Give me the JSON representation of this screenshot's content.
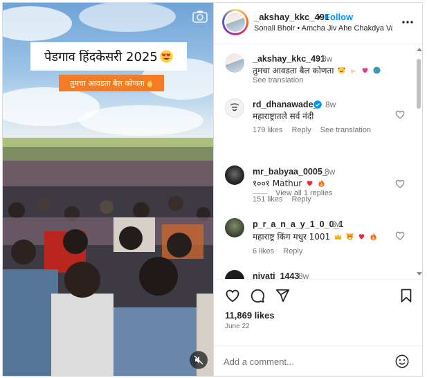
{
  "media": {
    "overlay_title": "पेडगाव हिंदकेसरी 2025",
    "overlay_subtitle": "तुमचा आवडता बैल कोणता",
    "camera_icon": "camera-icon",
    "mute_icon": "speaker-muted-icon",
    "colors": {
      "subtitle_bg": "#f47c24",
      "title_bg": "#ffffff"
    }
  },
  "header": {
    "username": "_akshay_kkc_491",
    "separator": "•",
    "follow_label": "Follow",
    "audio": "Sonali Bhoir • Amcha Jiv Ahe Chakdya Vari",
    "more_icon": "more-horizontal-icon"
  },
  "caption": {
    "username": "_akshay_kkc_491",
    "time": "8w",
    "text": "तुमचा आवडता बैल कोणता",
    "see_translation": "See translation"
  },
  "comments": [
    {
      "username": "rd_dhanawade_",
      "verified": true,
      "time": "8w",
      "text": "महाराष्ट्रातले सर्व नंदी",
      "likes": "179 likes",
      "reply": "Reply",
      "see_translation": "See translation",
      "view_replies": "View all 1 replies"
    },
    {
      "username": "mr_babyaa_0005_",
      "time": "8w",
      "text": "१००१ Mathur",
      "likes": "151 likes",
      "reply": "Reply"
    },
    {
      "username": "p_r_a_n_a_y_1_0_0_1",
      "time": "8w",
      "text": "महाराष्ट्र किंग मधुर 1001",
      "likes": "6 likes",
      "reply": "Reply"
    },
    {
      "username": "nivati_1443",
      "time": "8w"
    }
  ],
  "actions": {
    "like_icon": "heart-icon",
    "comment_icon": "comment-icon",
    "share_icon": "share-icon",
    "save_icon": "bookmark-icon",
    "likes": "11,869 likes",
    "date": "June 22"
  },
  "add_comment": {
    "placeholder": "Add a comment...",
    "emoji_icon": "emoji-icon"
  }
}
